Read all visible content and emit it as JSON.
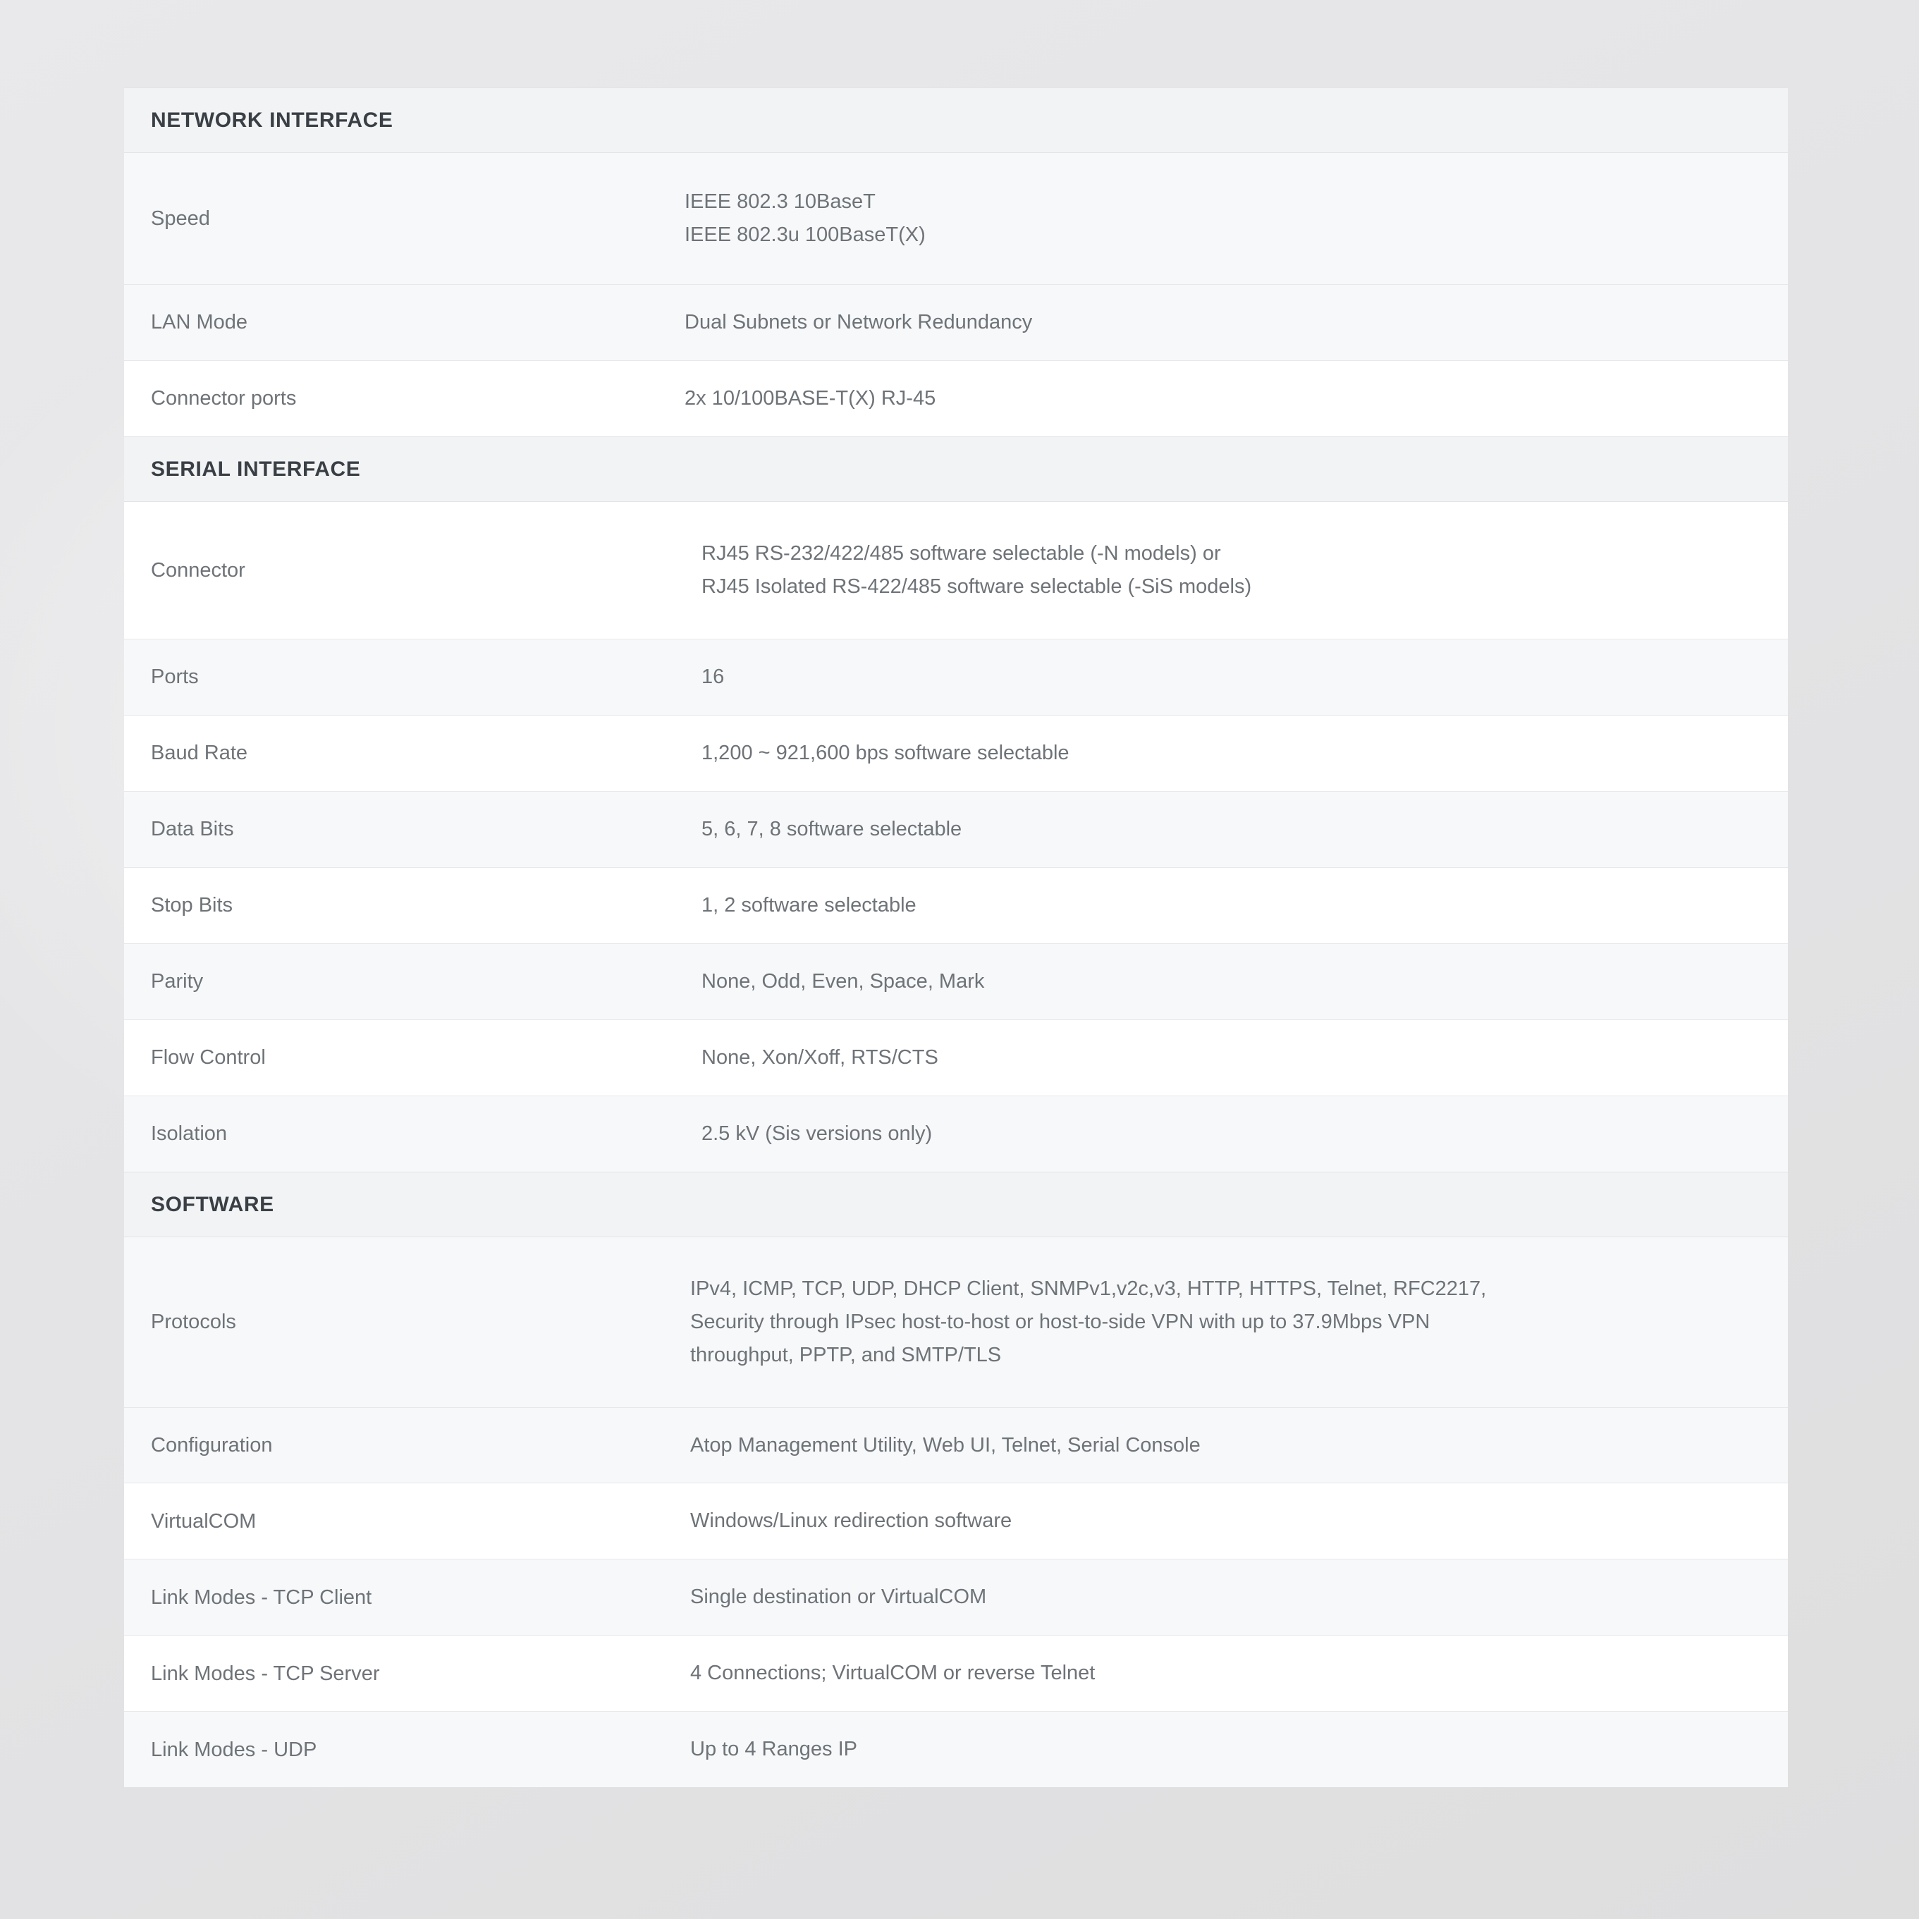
{
  "colors": {
    "page_background": "#e6e6e8",
    "card_background": "#ffffff",
    "section_header_background": "#f2f3f5",
    "alt_row_background": "#f7f8f9",
    "label_text": "#6e7378",
    "section_title_text": "#3a3f45",
    "row_divider": "#e7e8ea"
  },
  "spec_table": {
    "sections": [
      {
        "title": "NETWORK INTERFACE",
        "rows": [
          {
            "label": "Speed",
            "lines": [
              "IEEE 802.3 10BaseT",
              "IEEE 802.3u 100BaseT(X)"
            ]
          },
          {
            "label": "LAN Mode",
            "lines": [
              "Dual Subnets or Network Redundancy"
            ]
          },
          {
            "label": "Connector ports",
            "lines": [
              "2x 10/100BASE-T(X) RJ-45"
            ]
          }
        ]
      },
      {
        "title": "SERIAL INTERFACE",
        "rows": [
          {
            "label": "Connector",
            "lines": [
              "RJ45 RS-232/422/485 software selectable (-N models) or",
              "RJ45 Isolated RS-422/485 software selectable (-SiS models)"
            ]
          },
          {
            "label": "Ports",
            "lines": [
              "16"
            ]
          },
          {
            "label": "Baud Rate",
            "lines": [
              "1,200 ~ 921,600 bps software selectable"
            ]
          },
          {
            "label": "Data Bits",
            "lines": [
              "5, 6, 7, 8 software selectable"
            ]
          },
          {
            "label": "Stop Bits",
            "lines": [
              "1, 2 software selectable"
            ]
          },
          {
            "label": "Parity",
            "lines": [
              "None, Odd, Even, Space, Mark"
            ]
          },
          {
            "label": "Flow Control",
            "lines": [
              "None, Xon/Xoff, RTS/CTS"
            ]
          },
          {
            "label": "Isolation",
            "lines": [
              "2.5 kV (Sis versions only)"
            ]
          }
        ]
      },
      {
        "title": "SOFTWARE",
        "rows": [
          {
            "label": "Protocols",
            "lines": [
              "IPv4, ICMP, TCP, UDP, DHCP Client, SNMPv1,v2c,v3, HTTP, HTTPS, Telnet, RFC2217,",
              "Security through IPsec host-to-host or host-to-side VPN with up to 37.9Mbps VPN",
              "throughput, PPTP, and SMTP/TLS"
            ]
          },
          {
            "label": "Configuration",
            "lines": [
              "Atop Management Utility, Web UI, Telnet, Serial Console"
            ]
          },
          {
            "label": "VirtualCOM",
            "lines": [
              "Windows/Linux redirection software"
            ]
          },
          {
            "label": "Link Modes - TCP Client",
            "lines": [
              "Single destination or VirtualCOM"
            ]
          },
          {
            "label": "Link Modes - TCP Server",
            "lines": [
              "4 Connections; VirtualCOM or reverse Telnet"
            ]
          },
          {
            "label": "Link Modes - UDP",
            "lines": [
              "Up to 4 Ranges IP"
            ]
          }
        ]
      }
    ]
  }
}
